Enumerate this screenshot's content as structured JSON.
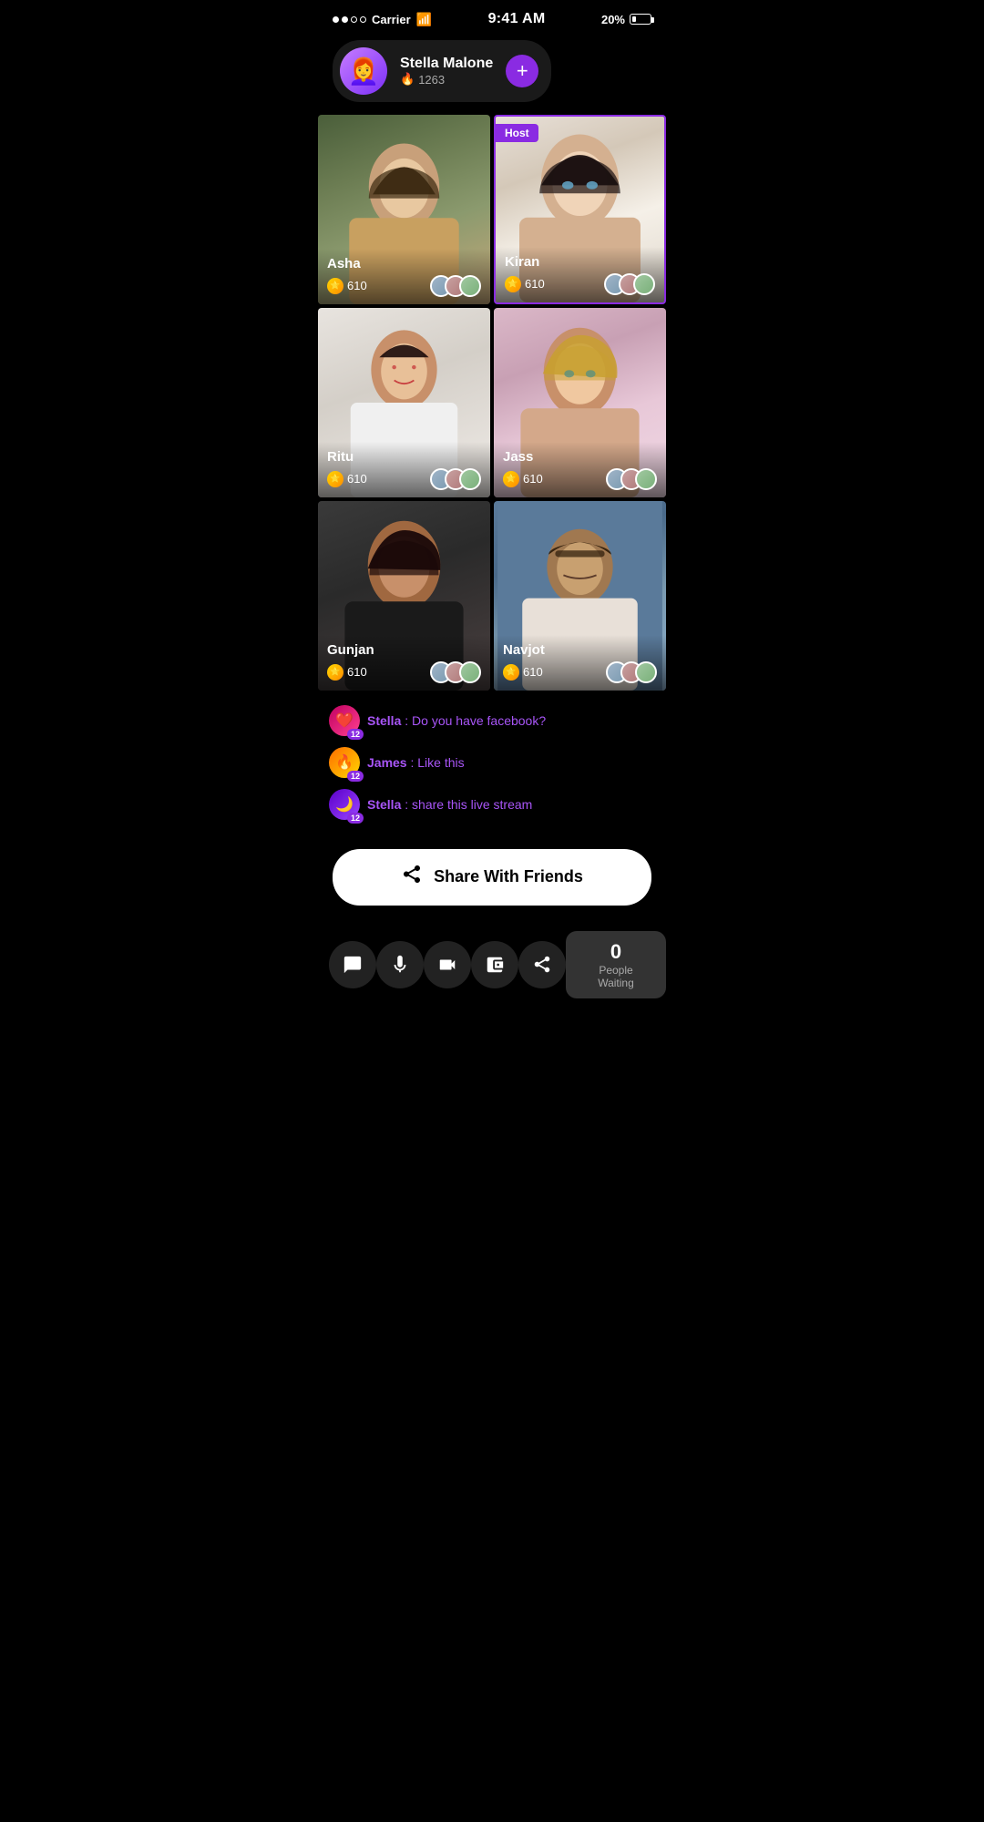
{
  "statusBar": {
    "carrier": "Carrier",
    "time": "9:41 AM",
    "battery": "20%"
  },
  "userHeader": {
    "name": "Stella Malone",
    "score": "1263",
    "followLabel": "+"
  },
  "videoGrid": [
    {
      "id": "asha",
      "name": "Asha",
      "coins": "610",
      "isHost": false,
      "colorClass": "cell-asha"
    },
    {
      "id": "kiran",
      "name": "Kiran",
      "coins": "610",
      "isHost": true,
      "colorClass": "cell-kiran"
    },
    {
      "id": "ritu",
      "name": "Ritu",
      "coins": "610",
      "isHost": false,
      "colorClass": "cell-ritu"
    },
    {
      "id": "jass",
      "name": "Jass",
      "coins": "610",
      "isHost": false,
      "colorClass": "cell-jass"
    },
    {
      "id": "gunjan",
      "name": "Gunjan",
      "coins": "610",
      "isHost": false,
      "colorClass": "cell-gunjan"
    },
    {
      "id": "navjot",
      "name": "Navjot",
      "coins": "610",
      "isHost": false,
      "colorClass": "cell-navjot"
    }
  ],
  "hostBadge": "Host",
  "chat": [
    {
      "user": "Stella",
      "level": "12",
      "message": "Do you have facebook?",
      "avatarType": "heart"
    },
    {
      "user": "James",
      "level": "12",
      "message": "Like this",
      "avatarType": "fire"
    },
    {
      "user": "Stella",
      "level": "12",
      "message": "share this live stream",
      "avatarType": "purple2"
    }
  ],
  "shareButton": {
    "label": "Share With Friends",
    "icon": "share"
  },
  "bottomNav": {
    "buttons": [
      {
        "id": "chat",
        "icon": "💬"
      },
      {
        "id": "mic",
        "icon": "🎤"
      },
      {
        "id": "video",
        "icon": "🎬"
      },
      {
        "id": "wallet",
        "icon": "👛"
      },
      {
        "id": "share",
        "icon": "📤"
      }
    ],
    "peopleWaiting": {
      "count": "0",
      "label": "People Waiting"
    }
  }
}
